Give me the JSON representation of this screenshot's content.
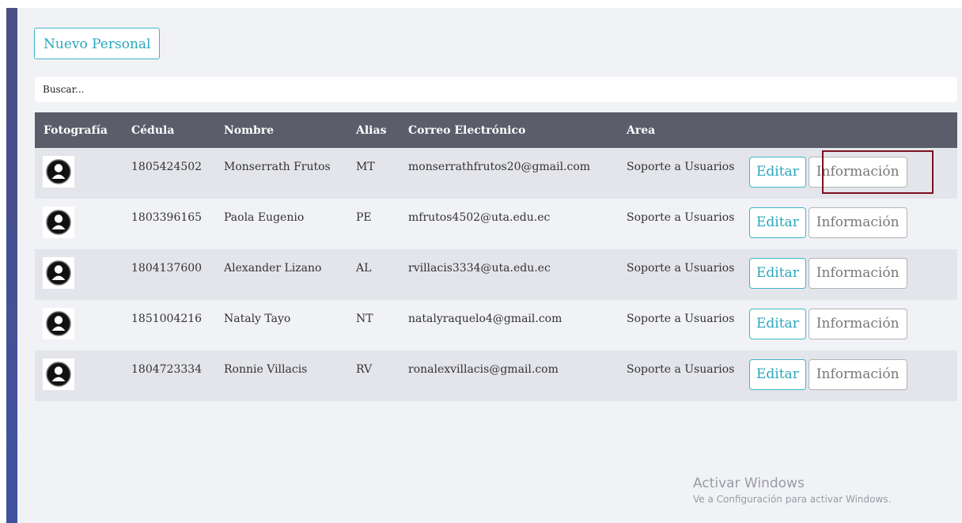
{
  "toolbar": {
    "new_button": "Nuevo Personal"
  },
  "search": {
    "placeholder": "Buscar..."
  },
  "table": {
    "columns": [
      "Fotografía",
      "Cédula",
      "Nombre",
      "Alias",
      "Correo Electrónico",
      "Area",
      ""
    ],
    "rows": [
      {
        "cedula": "1805424502",
        "nombre": "Monserrath Frutos",
        "alias": "MT",
        "correo": "monserrathfrutos20@gmail.com",
        "area": "Soporte a Usuarios",
        "editar": "Editar",
        "informacion": "Información"
      },
      {
        "cedula": "1803396165",
        "nombre": "Paola Eugenio",
        "alias": "PE",
        "correo": "mfrutos4502@uta.edu.ec",
        "area": "Soporte a Usuarios",
        "editar": "Editar",
        "informacion": "Información"
      },
      {
        "cedula": "1804137600",
        "nombre": "Alexander Lizano",
        "alias": "AL",
        "correo": "rvillacis3334@uta.edu.ec",
        "area": "Soporte a Usuarios",
        "editar": "Editar",
        "informacion": "Información"
      },
      {
        "cedula": "1851004216",
        "nombre": "Nataly Tayo",
        "alias": "NT",
        "correo": "natalyraquelo4@gmail.com",
        "area": "Soporte a Usuarios",
        "editar": "Editar",
        "informacion": "Información"
      },
      {
        "cedula": "1804723334",
        "nombre": "Ronnie Villacis",
        "alias": "RV",
        "correo": "ronalexvillacis@gmail.com",
        "area": "Soporte a Usuarios",
        "editar": "Editar",
        "informacion": "Información"
      }
    ]
  },
  "watermark": {
    "title": "Activar Windows",
    "subtitle": "Ve a Configuración para activar Windows."
  },
  "icons": {
    "avatar": "user-avatar-icon"
  },
  "colors": {
    "accent": "#2aa7bb",
    "header_bg": "#5b5d6a",
    "highlight": "#7a1222",
    "sidebar": "#3f52a0"
  }
}
